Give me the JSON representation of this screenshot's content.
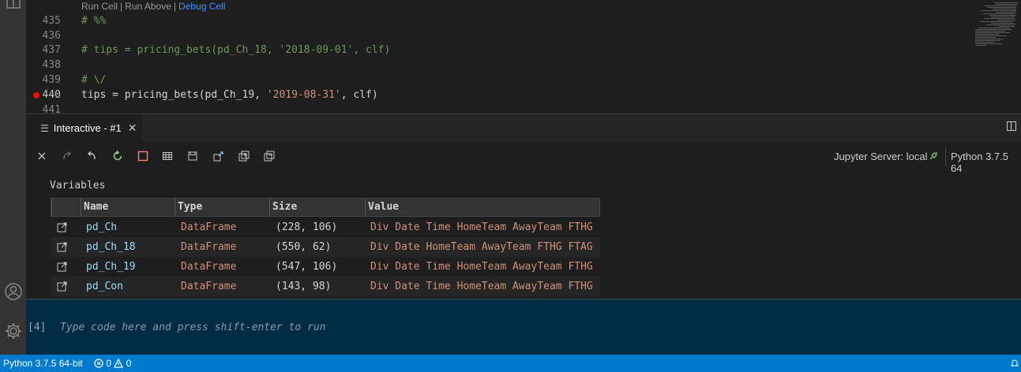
{
  "editor": {
    "codelens": {
      "run_cell": "Run Cell",
      "sep1": "|",
      "run_above": "Run Above",
      "sep2": "|",
      "debug_cell": "Debug Cell"
    },
    "lines": [
      {
        "number": "435",
        "text": "# %%"
      },
      {
        "number": "436",
        "text": ""
      },
      {
        "number": "437",
        "text": "# tips = pricing_bets(pd_Ch_18, '2018-09-01', clf)"
      },
      {
        "number": "438",
        "text": ""
      },
      {
        "number": "439",
        "text": "# \\/"
      },
      {
        "number": "440",
        "pre": "tips = pricing_bets(pd_Ch_19, ",
        "str": "'2019-08-31'",
        "post": ", clf)"
      },
      {
        "number": "441",
        "text": ""
      }
    ]
  },
  "interactive": {
    "tab_label": "Interactive - #1",
    "close_glyph": "✕",
    "jupyter_server": "Jupyter Server: local",
    "kernel": "Python 3.7.5 64"
  },
  "variables": {
    "title": "Variables",
    "columns": [
      "Name",
      "Type",
      "Size",
      "Value"
    ],
    "rows": [
      {
        "name": "pd_Ch",
        "type": "DataFrame",
        "size": "(228, 106)",
        "value": "Div Date Time HomeTeam AwayTeam FTHG"
      },
      {
        "name": "pd_Ch_18",
        "type": "DataFrame",
        "size": "(550, 62)",
        "value": "Div Date HomeTeam AwayTeam FTHG FTAG"
      },
      {
        "name": "pd_Ch_19",
        "type": "DataFrame",
        "size": "(547, 106)",
        "value": "Div Date Time HomeTeam AwayTeam FTHG"
      },
      {
        "name": "pd_Con",
        "type": "DataFrame",
        "size": "(143, 98)",
        "value": "Div Date Time HomeTeam AwayTeam FTHG"
      }
    ]
  },
  "input": {
    "prompt": "[4]",
    "placeholder": "Type code here and press shift-enter to run"
  },
  "statusbar": {
    "interpreter": "Python 3.7.5 64-bit",
    "errors": "0",
    "warnings": "0"
  },
  "colors": {
    "statusbar": "#007acc",
    "input_bg": "#002b45",
    "breakpoint": "#e51400",
    "link": "#3794ff"
  },
  "icons": [
    "files-icon",
    "account-icon",
    "gear-icon",
    "clear-icon",
    "redo-icon",
    "undo-icon",
    "restart-icon",
    "interrupt-icon",
    "variables-icon",
    "save-icon",
    "export-icon",
    "expand-all-icon",
    "collapse-all-icon",
    "plug-icon",
    "split-editor-icon",
    "open-data-viewer-icon"
  ]
}
